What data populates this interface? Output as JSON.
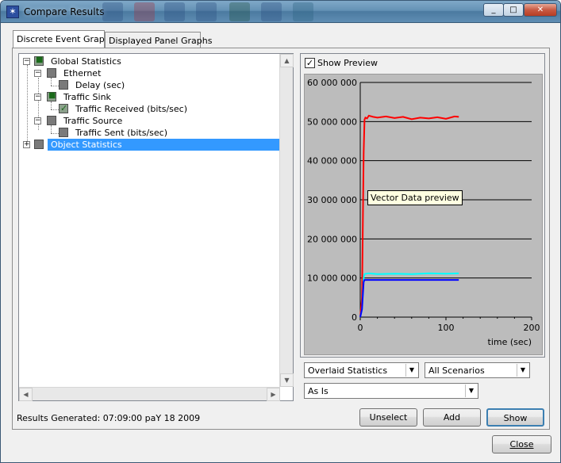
{
  "window": {
    "title": "Compare Results",
    "minimize": "_",
    "maximize": "□",
    "close": "✕"
  },
  "tabs": [
    {
      "label": "Discrete Event Graphs",
      "active": true
    },
    {
      "label": "Displayed Panel Graphs",
      "active": false
    }
  ],
  "tree": {
    "items": [
      {
        "label": "Global Statistics",
        "expander": "−"
      },
      {
        "label": "Ethernet",
        "expander": "−"
      },
      {
        "label": "Delay (sec)"
      },
      {
        "label": "Traffic Sink",
        "expander": "−"
      },
      {
        "label": "Traffic Received (bits/sec)"
      },
      {
        "label": "Traffic Source",
        "expander": "−"
      },
      {
        "label": "Traffic Sent (bits/sec)"
      },
      {
        "label": "Object Statistics",
        "expander": "+"
      }
    ]
  },
  "preview": {
    "show_preview_label": "Show Preview",
    "show_preview_checked": true,
    "tooltip": "Vector Data preview"
  },
  "chart_data": {
    "type": "line",
    "xlabel": "time (sec)",
    "ylabel": "",
    "xlim": [
      0,
      200
    ],
    "ylim": [
      0,
      60000000
    ],
    "x_ticks": [
      "0",
      "100",
      "200"
    ],
    "y_ticks": [
      "0",
      "10 000 000",
      "20 000 000",
      "30 000 000",
      "40 000 000",
      "50 000 000",
      "60 000 000"
    ],
    "grid": true,
    "series": [
      {
        "color": "#ff0000",
        "x": [
          0,
          2,
          4,
          5,
          6,
          8,
          10,
          15,
          20,
          30,
          40,
          50,
          60,
          70,
          80,
          90,
          100,
          110,
          115
        ],
        "values": [
          0,
          5000000,
          42000000,
          50500000,
          51000000,
          50800000,
          51500000,
          51200000,
          51000000,
          51300000,
          50900000,
          51200000,
          50600000,
          51000000,
          50800000,
          51100000,
          50700000,
          51300000,
          51200000
        ]
      },
      {
        "color": "#00ffff",
        "x": [
          0,
          2,
          4,
          5,
          10,
          20,
          40,
          60,
          80,
          100,
          115
        ],
        "values": [
          0,
          2000000,
          10000000,
          11000000,
          11200000,
          11000000,
          11100000,
          11000000,
          11200000,
          11100000,
          11200000
        ]
      },
      {
        "color": "#0000ff",
        "x": [
          0,
          2,
          4,
          5,
          10,
          20,
          40,
          60,
          80,
          100,
          115
        ],
        "values": [
          0,
          2000000,
          9000000,
          9500000,
          9500000,
          9500000,
          9500000,
          9500000,
          9500000,
          9500000,
          9500000
        ]
      }
    ]
  },
  "controls": {
    "overlay_select": "Overlaid Statistics",
    "scenario_select": "All Scenarios",
    "filter_select": "As Is"
  },
  "buttons": {
    "unselect": "Unselect",
    "add": "Add",
    "show": "Show",
    "close": "Close"
  },
  "status": {
    "text": "Results Generated: 07:09:00 paY 18 2009"
  }
}
